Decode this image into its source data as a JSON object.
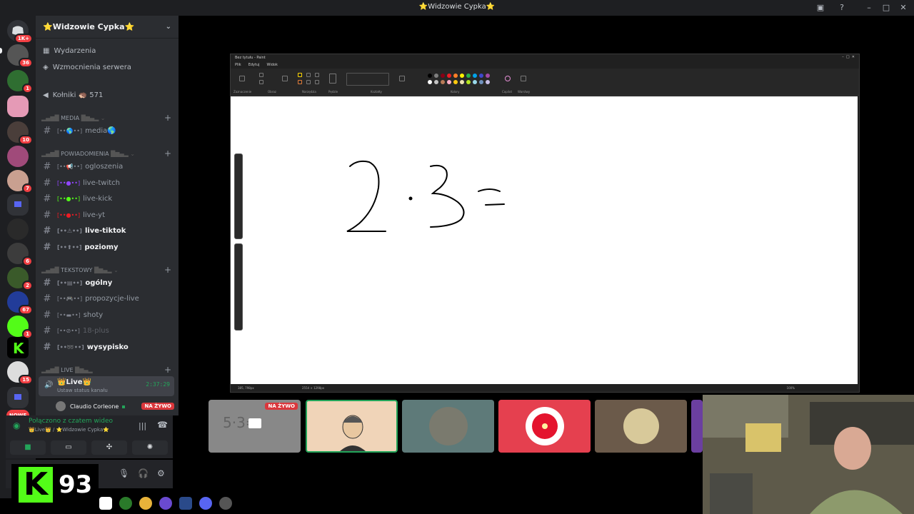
{
  "window": {
    "title": "⭐Widzowie Cypka⭐"
  },
  "rail": {
    "home_badge": "1K+",
    "badges": [
      "36",
      "1",
      "10",
      "7",
      "6",
      "2",
      "67",
      "1",
      "15"
    ],
    "new_label": "NOWE"
  },
  "sidebar": {
    "server_name": "⭐Widzowie Cypka⭐",
    "events": "Wydarzenia",
    "boosts": "Wzmocnienia serwera",
    "kolniki": "Kołniki 🦔 571",
    "categories": {
      "media": "MEDIA",
      "powiadomienia": "POWIADOMIENIA",
      "tekstowy": "TEKSTOWY",
      "live": "LIVE"
    },
    "channels": {
      "media": "media🌎",
      "ogloszenia": "ogloszenia",
      "live_twitch": "live-twitch",
      "live_kick": "live-kick",
      "live_yt": "live-yt",
      "live_tiktok": "live-tiktok",
      "poziomy": "poziomy",
      "ogolny": "ogólny",
      "propozycje_live": "propozycje-live",
      "shoty": "shoty",
      "plus18": "18-plus",
      "wysypisko": "wysypisko"
    },
    "voice_channel": {
      "name": "👑Live👑",
      "status_hint": "Ustaw status kanału",
      "time": "2:37:29"
    },
    "speaker": {
      "name": "Claudio Corleone",
      "badge": "NA ŻYWO"
    }
  },
  "voice_panel": {
    "status": "Połączono z czatem wideo",
    "location": "👑Live👑 / ⭐Widzowie Cypka⭐"
  },
  "kick_overlay": {
    "logo_letter": "K",
    "count": "93"
  },
  "paint": {
    "title": "Bez tytułu - Paint",
    "menu": [
      "Plik",
      "Edytuj",
      "Widok"
    ],
    "ribbon_groups": [
      "Zaznaczenie",
      "Obraz",
      "Narzędzia",
      "Pędzle",
      "Kształty",
      "Kolory",
      "Copilot",
      "Warstwy"
    ],
    "palette": [
      "#000000",
      "#7f7f7f",
      "#880015",
      "#ed1c24",
      "#ff7f27",
      "#fff200",
      "#22b14c",
      "#00a2e8",
      "#3f48cc",
      "#a349a4",
      "#ffffff",
      "#c3c3c3",
      "#b97a57",
      "#ffaec9",
      "#ffc90e",
      "#efe4b0",
      "#b5e61d",
      "#99d9ea",
      "#7092be",
      "#c8bfe7"
    ],
    "status_left": "385, 798px",
    "status_size": "2554 × 1298px",
    "zoom": "100%"
  },
  "stream_tiles": {
    "first_badge": "NA ŻYWO"
  },
  "colors": {
    "discord_bg": "#2b2d31",
    "rail_bg": "#1e1f22",
    "green": "#23a55a",
    "red": "#da373c",
    "kick_green": "#53fc18"
  }
}
